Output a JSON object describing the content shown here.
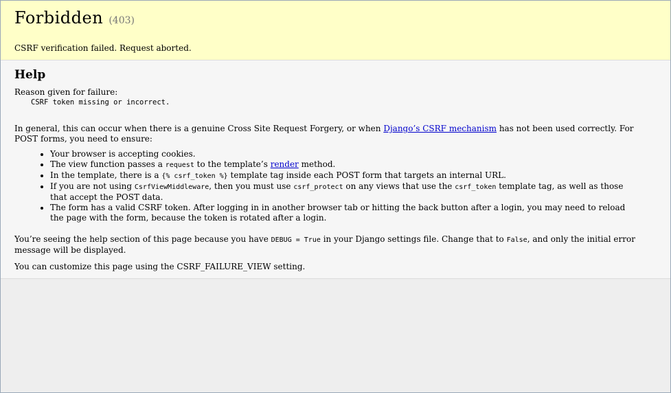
{
  "summary": {
    "title": "Forbidden",
    "status_code": "(403)",
    "message": "CSRF verification failed. Request aborted."
  },
  "help": {
    "heading": "Help",
    "reason_label": "Reason given for failure:",
    "reason_text": "CSRF token missing or incorrect.",
    "general_prefix": "In general, this can occur when there is a genuine Cross Site Request Forgery, or when ",
    "csrf_link_text": "Django’s CSRF mechanism",
    "general_suffix": " has not been used correctly. For POST forms, you need to ensure:",
    "items": [
      {
        "text": "Your browser is accepting cookies."
      },
      {
        "text_a": "The view function passes a ",
        "code": "request",
        "text_b": " to the template’s ",
        "link_text": "render",
        "text_c": " method."
      },
      {
        "text_a": "In the template, there is a ",
        "code": "{% csrf_token %}",
        "text_b": " template tag inside each POST form that targets an internal URL."
      },
      {
        "text_a": "If you are not using ",
        "code_a": "CsrfViewMiddleware",
        "text_b": ", then you must use ",
        "code_b": "csrf_protect",
        "text_c": " on any views that use the ",
        "code_c": "csrf_token",
        "text_d": " template tag, as well as those that accept the POST data."
      },
      {
        "text": "The form has a valid CSRF token. After logging in in another browser tab or hitting the back button after a login, you may need to reload the page with the form, because the token is rotated after a login."
      }
    ],
    "debug_a": "You’re seeing the help section of this page because you have ",
    "debug_code_a": "DEBUG = True",
    "debug_b": " in your Django settings file. Change that to ",
    "debug_code_b": "False",
    "debug_c": ", and only the initial error message will be displayed.",
    "customize": "You can customize this page using the CSRF_FAILURE_VIEW setting."
  }
}
